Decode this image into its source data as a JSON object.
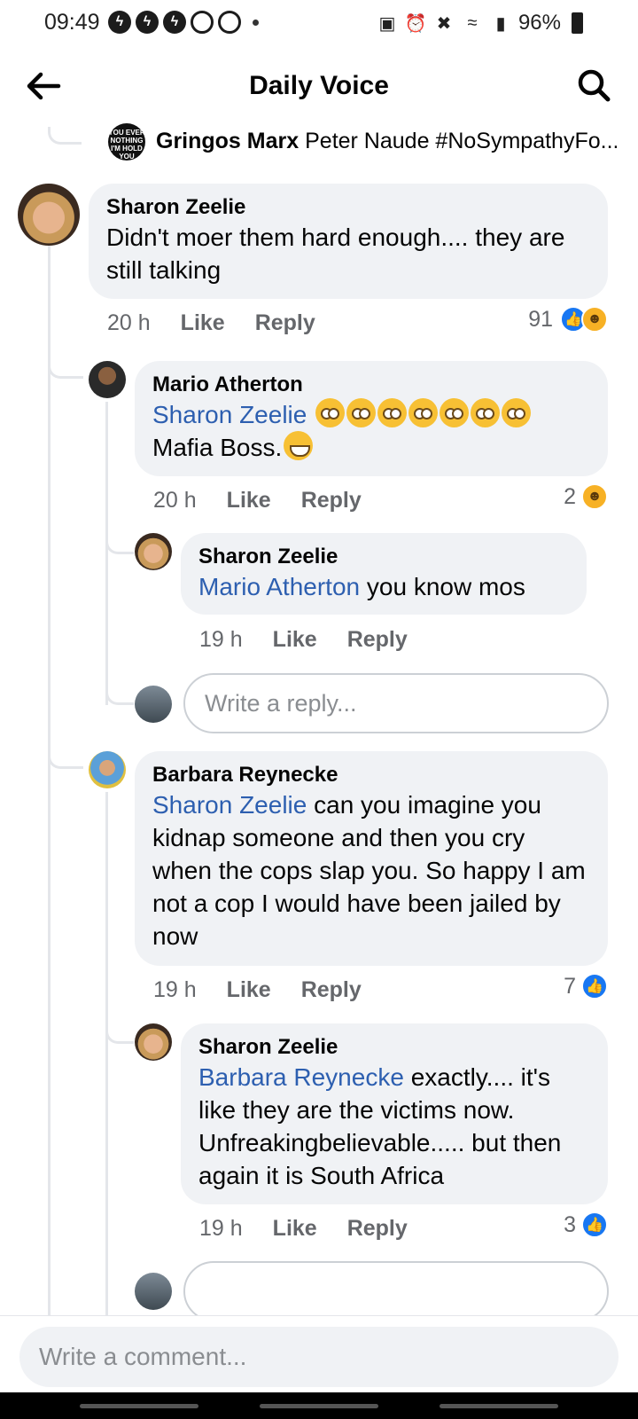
{
  "status_bar": {
    "time": "09:49",
    "battery": "96%"
  },
  "header": {
    "title": "Daily Voice"
  },
  "collapsed_reply": {
    "author": "Gringos Marx",
    "text": "Peter Naude #NoSympathyFo...",
    "avatar_text": "YOU EVER NOTHING I'M HOLD YOU"
  },
  "comments": [
    {
      "author": "Sharon Zeelie",
      "mention": "",
      "text": "Didn't moer them hard enough.... they are still talking",
      "age": "20 h",
      "like_label": "Like",
      "reply_label": "Reply",
      "reaction_count": "91"
    },
    {
      "author": "Mario Atherton",
      "mention": "Sharon Zeelie",
      "text": "Mafia Boss.",
      "age": "20 h",
      "like_label": "Like",
      "reply_label": "Reply",
      "reaction_count": "2"
    },
    {
      "author": "Sharon Zeelie",
      "mention": "Mario Atherton",
      "text": "you know mos",
      "age": "19 h",
      "like_label": "Like",
      "reply_label": "Reply",
      "reaction_count": ""
    },
    {
      "author": "Barbara Reynecke",
      "mention": "Sharon Zeelie",
      "text": "can you imagine you kidnap someone and then you cry when the cops slap you. So happy I am not a cop I would have been jailed by now",
      "age": "19 h",
      "like_label": "Like",
      "reply_label": "Reply",
      "reaction_count": "7"
    },
    {
      "author": "Sharon Zeelie",
      "mention": "Barbara Reynecke",
      "text": "exactly.... it's like they are the victims now. Unfreakingbelievable..... but then again it is South Africa",
      "age": "19 h",
      "like_label": "Like",
      "reply_label": "Reply",
      "reaction_count": "3"
    }
  ],
  "reply_placeholder": "Write a reply...",
  "comment_placeholder": "Write a comment...",
  "icons": {
    "back": "arrow-left-icon",
    "search": "search-icon",
    "like_reaction": "like-reaction-icon",
    "haha_reaction": "haha-reaction-icon"
  },
  "colors": {
    "mention": "#2d5fb0",
    "bubble": "#f0f2f5",
    "like_blue": "#1877f2"
  }
}
